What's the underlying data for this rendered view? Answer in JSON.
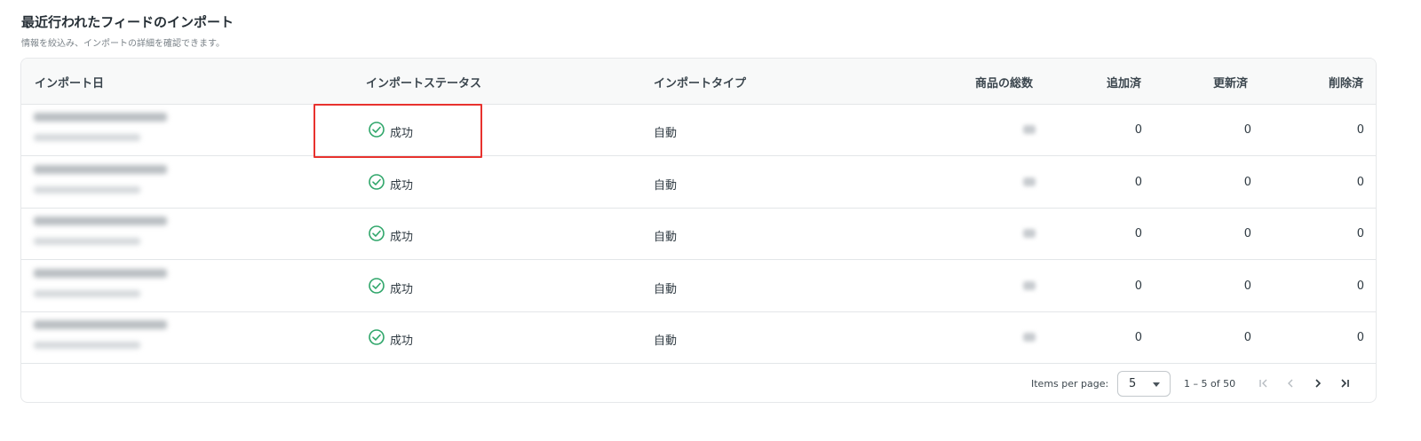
{
  "header": {
    "title": "最近行われたフィードのインポート",
    "subtitle": "情報を絞込み、インポートの詳細を確認できます。"
  },
  "table": {
    "columns": {
      "date": "インポート日",
      "status": "インポートステータス",
      "type": "インポートタイプ",
      "total": "商品の総数",
      "added": "追加済",
      "updated": "更新済",
      "deleted": "削除済"
    },
    "rows": [
      {
        "status": "成功",
        "type": "自動",
        "added": "0",
        "updated": "0",
        "deleted": "0"
      },
      {
        "status": "成功",
        "type": "自動",
        "added": "0",
        "updated": "0",
        "deleted": "0"
      },
      {
        "status": "成功",
        "type": "自動",
        "added": "0",
        "updated": "0",
        "deleted": "0"
      },
      {
        "status": "成功",
        "type": "自動",
        "added": "0",
        "updated": "0",
        "deleted": "0"
      },
      {
        "status": "成功",
        "type": "自動",
        "added": "0",
        "updated": "0",
        "deleted": "0"
      }
    ]
  },
  "pagination": {
    "items_per_page_label": "Items per page:",
    "items_per_page_value": "5",
    "range_label": "1 – 5 of 50"
  },
  "colors": {
    "success": "#2fa66a",
    "highlight": "#e8322e"
  },
  "icons": {
    "status": "check-circle-icon",
    "first": "first-page-icon",
    "prev": "chevron-left-icon",
    "next": "chevron-right-icon",
    "last": "last-page-icon",
    "dropdown": "caret-down-icon"
  }
}
